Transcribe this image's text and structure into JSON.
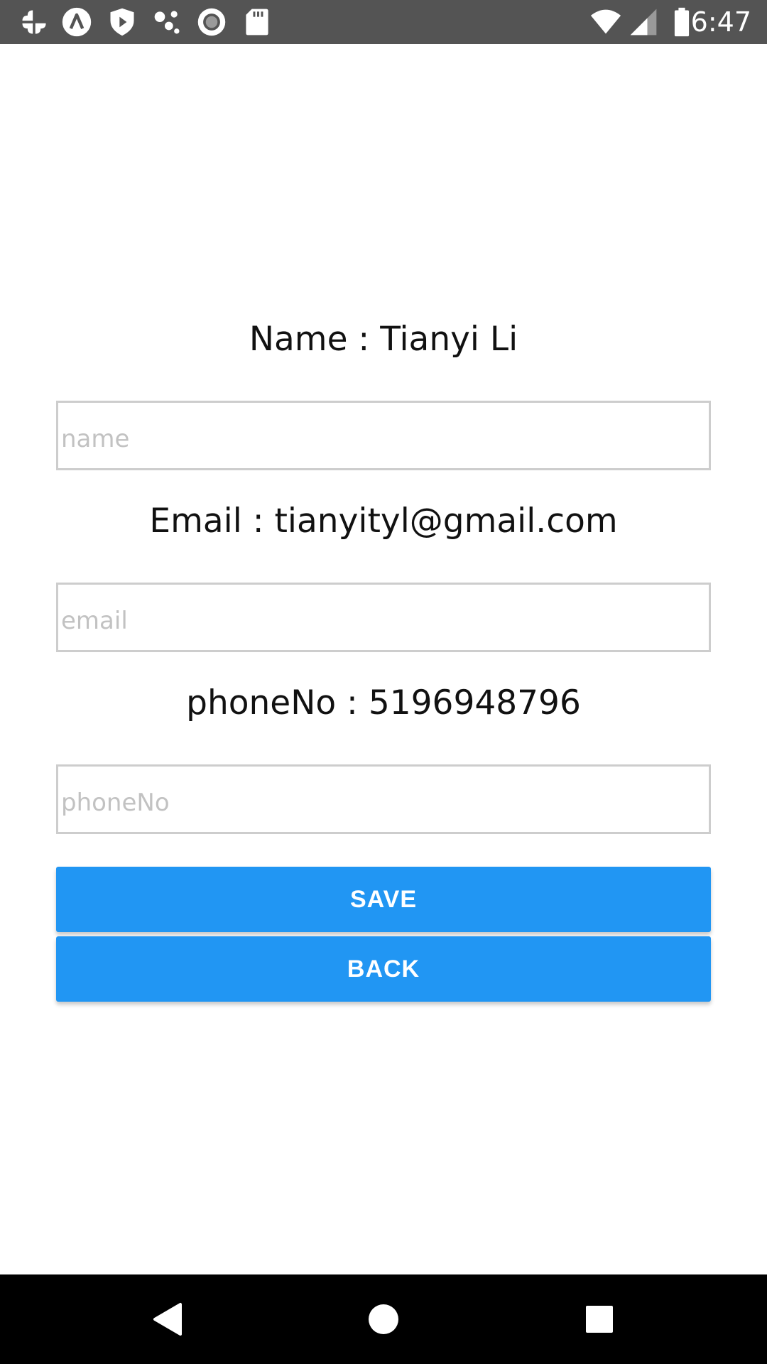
{
  "status_bar": {
    "time": "6:47",
    "left_icons": [
      "pinwheel-icon",
      "app-a-icon",
      "shield-play-icon",
      "nodes-icon",
      "record-icon",
      "sd-card-icon"
    ],
    "right_icons": [
      "wifi-icon",
      "cell-signal-icon",
      "battery-icon"
    ]
  },
  "form": {
    "name": {
      "label": "Name : Tianyi Li",
      "input_value": "",
      "placeholder": "name"
    },
    "email": {
      "label": "Email : tianyityl@gmail.com",
      "input_value": "",
      "placeholder": "email"
    },
    "phone": {
      "label": "phoneNo : 5196948796",
      "input_value": "",
      "placeholder": "phoneNo"
    },
    "save_label": "SAVE",
    "back_label": "BACK"
  },
  "nav_bar": {
    "buttons": [
      "back-triangle-icon",
      "home-circle-icon",
      "recents-square-icon"
    ]
  },
  "colors": {
    "button_blue": "#2196f3",
    "status_bar": "#545454",
    "nav_bar": "#000000",
    "input_border": "#cdcdcd",
    "placeholder": "#c2c2c2"
  }
}
